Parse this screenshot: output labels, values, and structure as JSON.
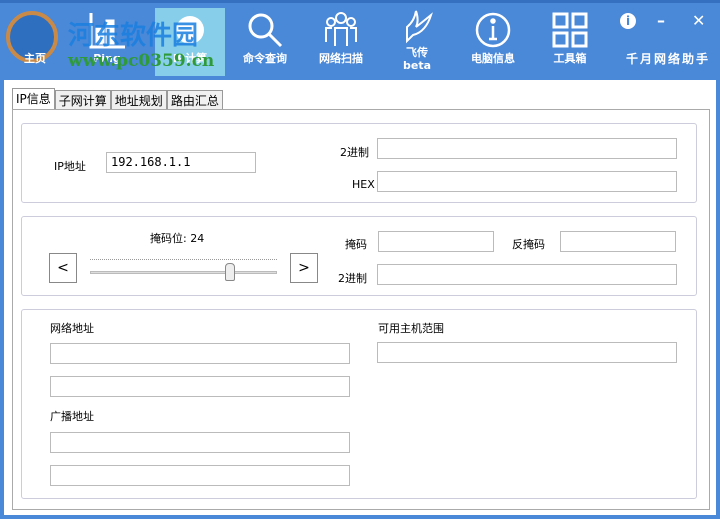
{
  "watermark": {
    "site": "河东软件园",
    "url": "www.pc0359.cn"
  },
  "nav": [
    {
      "label": "主页",
      "icon": "home-icon"
    },
    {
      "label": "Ping",
      "icon": "chart-icon"
    },
    {
      "label": "IP计算",
      "icon": "globe-icon"
    },
    {
      "label": "命令查询",
      "icon": "search-icon"
    },
    {
      "label": "网络扫描",
      "icon": "users-icon"
    },
    {
      "label": "飞传",
      "label2": "beta",
      "icon": "bird-icon"
    },
    {
      "label": "电脑信息",
      "icon": "info-icon"
    },
    {
      "label": "工具箱",
      "icon": "grid-icon"
    }
  ],
  "window": {
    "title": "千月网络助手",
    "info": "i",
    "minimize": "–",
    "close": "✕"
  },
  "tabs": [
    "IP信息",
    "子网计算",
    "地址规划",
    "路由汇总"
  ],
  "ipinfo": {
    "ip_label": "IP地址",
    "ip_value": "192.168.1.1",
    "bin_label": "2进制",
    "hex_label": "HEX",
    "bin_value": "",
    "hex_value": ""
  },
  "mask": {
    "bits_label": "掩码位: 24",
    "bits": 24,
    "max_bits": 32,
    "prev": "<",
    "next": ">",
    "mask_label": "掩码",
    "inv_label": "反掩码",
    "bin_label": "2进制"
  },
  "result": {
    "net_label": "网络地址",
    "bcast_label": "广播地址",
    "hosts_label": "可用主机范围"
  }
}
